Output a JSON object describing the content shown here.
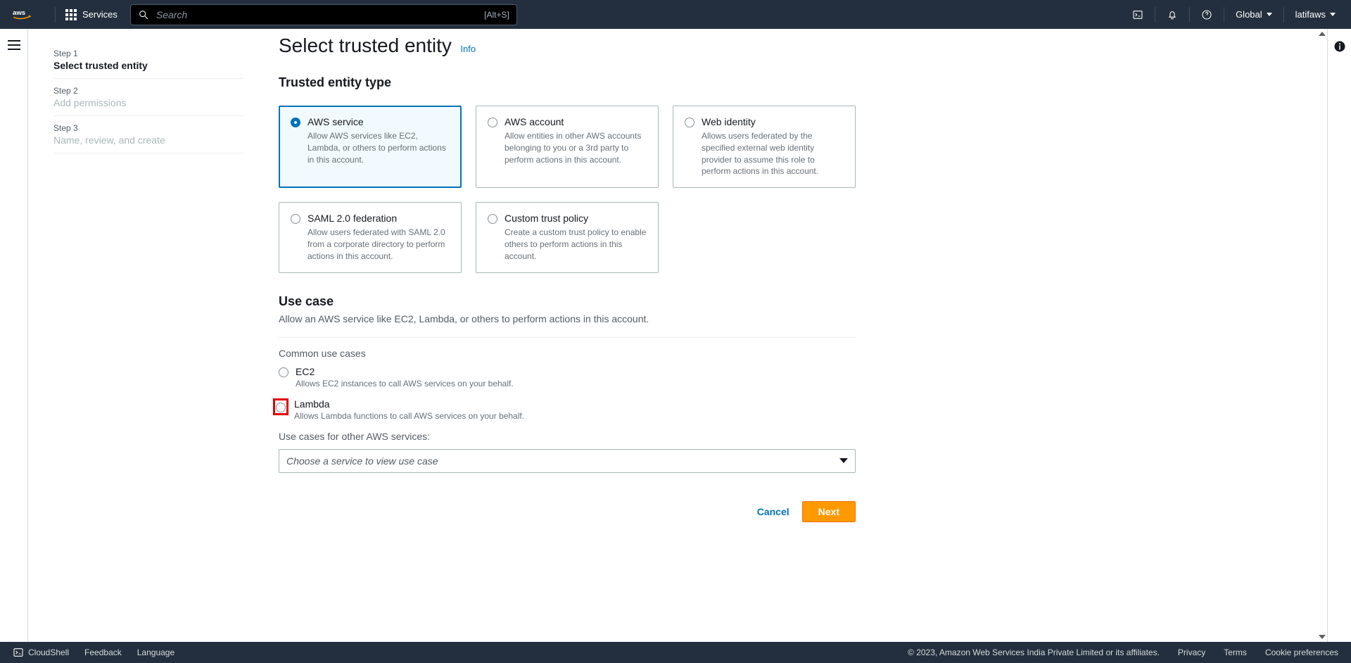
{
  "nav": {
    "services": "Services",
    "search_placeholder": "Search",
    "search_hint": "[Alt+S]",
    "region": "Global",
    "account": "latifaws"
  },
  "steps": [
    {
      "num": "Step 1",
      "title": "Select trusted entity",
      "active": true
    },
    {
      "num": "Step 2",
      "title": "Add permissions",
      "active": false
    },
    {
      "num": "Step 3",
      "title": "Name, review, and create",
      "active": false
    }
  ],
  "page": {
    "heading": "Select trusted entity",
    "info": "Info",
    "section_entity": "Trusted entity type",
    "entities": [
      {
        "title": "AWS service",
        "desc": "Allow AWS services like EC2, Lambda, or others to perform actions in this account.",
        "selected": true
      },
      {
        "title": "AWS account",
        "desc": "Allow entities in other AWS accounts belonging to you or a 3rd party to perform actions in this account.",
        "selected": false
      },
      {
        "title": "Web identity",
        "desc": "Allows users federated by the specified external web identity provider to assume this role to perform actions in this account.",
        "selected": false
      },
      {
        "title": "SAML 2.0 federation",
        "desc": "Allow users federated with SAML 2.0 from a corporate directory to perform actions in this account.",
        "selected": false
      },
      {
        "title": "Custom trust policy",
        "desc": "Create a custom trust policy to enable others to perform actions in this account.",
        "selected": false
      }
    ],
    "usecase_heading": "Use case",
    "usecase_sub": "Allow an AWS service like EC2, Lambda, or others to perform actions in this account.",
    "common_label": "Common use cases",
    "usecases": [
      {
        "title": "EC2",
        "desc": "Allows EC2 instances to call AWS services on your behalf.",
        "highlighted": false
      },
      {
        "title": "Lambda",
        "desc": "Allows Lambda functions to call AWS services on your behalf.",
        "highlighted": true
      }
    ],
    "other_label": "Use cases for other AWS services:",
    "select_placeholder": "Choose a service to view use case",
    "cancel": "Cancel",
    "next": "Next"
  },
  "footer": {
    "cloudshell": "CloudShell",
    "feedback": "Feedback",
    "language": "Language",
    "copyright": "© 2023, Amazon Web Services India Private Limited or its affiliates.",
    "privacy": "Privacy",
    "terms": "Terms",
    "cookies": "Cookie preferences"
  }
}
